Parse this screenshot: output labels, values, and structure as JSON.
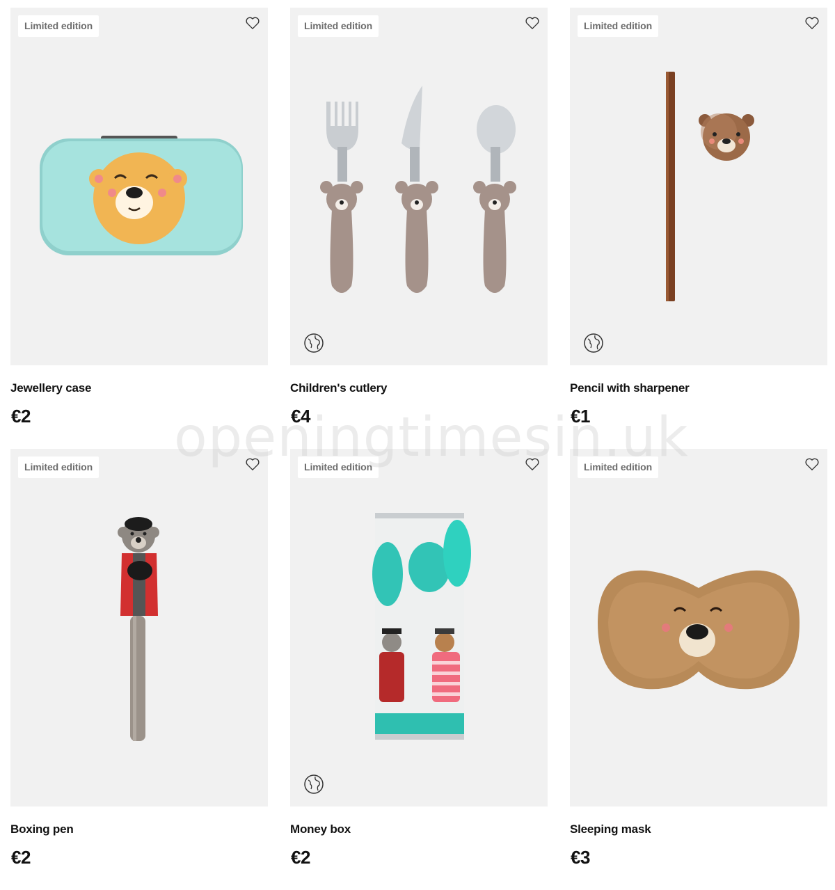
{
  "products": [
    {
      "badge": "Limited edition",
      "name": "Jewellery case",
      "price": "€2",
      "eco": false,
      "icon": "heart-outline"
    },
    {
      "badge": "Limited edition",
      "name": "Children's cutlery",
      "price": "€4",
      "eco": true,
      "icon": "heart-outline"
    },
    {
      "badge": "Limited edition",
      "name": "Pencil with sharpener",
      "price": "€1",
      "eco": true,
      "icon": "heart-outline"
    },
    {
      "badge": "Limited edition",
      "name": "Boxing pen",
      "price": "€2",
      "eco": false,
      "icon": "heart-outline"
    },
    {
      "badge": "Limited edition",
      "name": "Money box",
      "price": "€2",
      "eco": true,
      "icon": "heart-outline"
    },
    {
      "badge": "Limited edition",
      "name": "Sleeping mask",
      "price": "€3",
      "eco": false,
      "icon": "heart-outline"
    }
  ],
  "watermark": "openingtimesin.uk",
  "colors": {
    "card_bg": "#f1f1f1",
    "badge_text": "#6d6d6d",
    "text": "#111111"
  }
}
